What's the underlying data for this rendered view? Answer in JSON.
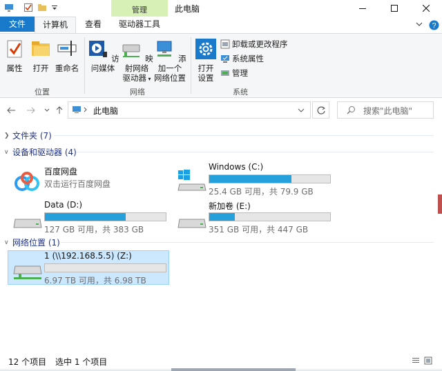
{
  "window": {
    "title": "此电脑",
    "context_tab_label": "管理"
  },
  "ribbon_tabs": {
    "file": "文件",
    "computer": "计算机",
    "view": "查看",
    "drive_tools": "驱动器工具"
  },
  "ribbon": {
    "groups": {
      "location": "位置",
      "network": "网络",
      "system": "系统"
    },
    "buttons": {
      "properties": "属性",
      "open": "打开",
      "rename": "重命名",
      "access_media": "访问媒体",
      "map_drive_1": "映射网络",
      "map_drive_2": "驱动器",
      "add_location_1": "添加一个",
      "add_location_2": "网络位置",
      "open_settings_1": "打开",
      "open_settings_2": "设置"
    },
    "small_items": {
      "uninstall": "卸载或更改程序",
      "system_properties": "系统属性",
      "manage": "管理"
    }
  },
  "nav": {
    "address": "此电脑",
    "search_placeholder": "搜索\"此电脑\""
  },
  "sections": {
    "folders": "文件夹 (7)",
    "devices": "设备和驱动器 (4)",
    "network": "网络位置 (1)"
  },
  "drives": [
    {
      "name": "百度网盘",
      "subtitle": "双击运行百度网盘",
      "icon": "baidu-netdisk-icon"
    },
    {
      "name": "Windows (C:)",
      "subtitle": "25.4 GB 可用，共 79.9 GB",
      "used_fraction": 0.68,
      "icon": "windows-drive-icon"
    },
    {
      "name": "Data (D:)",
      "subtitle": "127 GB 可用，共 383 GB",
      "used_fraction": 0.67,
      "icon": "hard-drive-icon"
    },
    {
      "name": "新加卷 (E:)",
      "subtitle": "351 GB 可用，共 447 GB",
      "used_fraction": 0.21,
      "icon": "hard-drive-icon"
    }
  ],
  "network_drives": [
    {
      "name": "1 (\\\\192.168.5.5) (Z:)",
      "subtitle": "6.97 TB 可用，共 6.98 TB",
      "used_fraction": 0.0,
      "icon": "network-drive-icon"
    }
  ],
  "status": {
    "item_count": "12 个项目",
    "selected": "选中 1 个项目"
  },
  "colors": {
    "accent": "#1979ca",
    "bar_fill": "#26a0da",
    "context_tab": "#d7f0b6",
    "selection": "#cce8ff"
  }
}
